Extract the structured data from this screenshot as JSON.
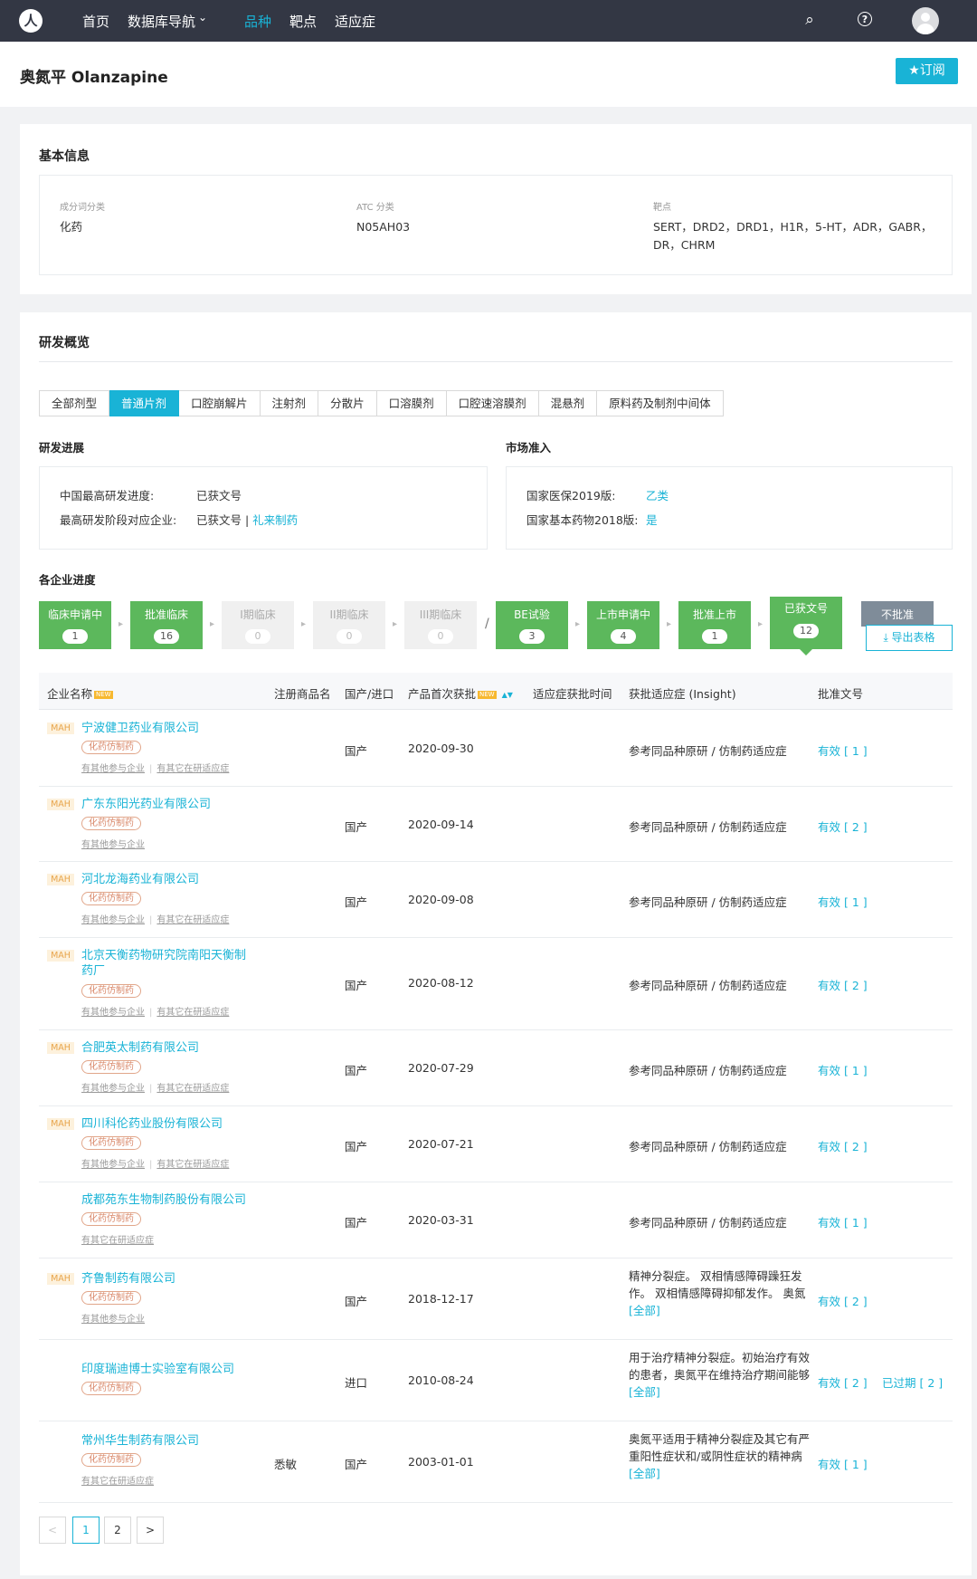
{
  "nav": {
    "logo": "人",
    "items": [
      "首页",
      "数据库导航",
      "品种",
      "靶点",
      "适应症"
    ],
    "dropdown_mark": "⌄",
    "search_icon": "⌕",
    "help_icon": "?"
  },
  "header": {
    "title": "奥氮平 Olanzapine",
    "subscribe": "★订阅"
  },
  "basic": {
    "title": "基本信息",
    "fields": [
      {
        "label": "成分词分类",
        "value": "化药"
      },
      {
        "label": "ATC 分类",
        "value": "N05AH03"
      },
      {
        "label": "靶点",
        "value": "SERT，DRD2，DRD1，H1R，5-HT，ADR，GABR，DR，CHRM"
      }
    ]
  },
  "rd": {
    "title": "研发概览",
    "tabs": [
      "全部剂型",
      "普通片剂",
      "口腔崩解片",
      "注射剂",
      "分散片",
      "口溶膜剂",
      "口腔速溶膜剂",
      "混悬剂",
      "原料药及制剂中间体"
    ],
    "progress_title": "研发进展",
    "progress": {
      "row1_label": "中国最高研发进度:",
      "row1_value": "已获文号",
      "row2_label": "最高研发阶段对应企业:",
      "row2_value": "已获文号 | ",
      "row2_link": "礼来制药"
    },
    "market_title": "市场准入",
    "market": {
      "row1_label": "国家医保2019版:",
      "row1_value": "乙类",
      "row2_label": "国家基本药物2018版:",
      "row2_value": "是"
    },
    "company_progress_title": "各企业进度",
    "stages": [
      {
        "name": "临床申请中",
        "count": "1"
      },
      {
        "name": "批准临床",
        "count": "16"
      },
      {
        "name": "I期临床",
        "count": "0"
      },
      {
        "name": "II期临床",
        "count": "0"
      },
      {
        "name": "III期临床",
        "count": "0"
      },
      {
        "name": "BE试验",
        "count": "3"
      },
      {
        "name": "上市申请中",
        "count": "4"
      },
      {
        "name": "批准上市",
        "count": "1"
      },
      {
        "name": "已获文号",
        "count": "12"
      },
      {
        "name": "不批准",
        "count": ""
      }
    ],
    "separator": "/",
    "export": "⤓ 导出表格"
  },
  "table": {
    "headers": [
      "企业名称",
      "注册商品名",
      "国产/进口",
      "产品首次获批",
      "适应症获批时间",
      "获批适应症 (Insight)",
      "批准文号"
    ],
    "new_badge": "NEW",
    "sort_mark": "▲▼",
    "mah": "MAH",
    "tag": "化药仿制药",
    "link_other_company": "有其他参与企业",
    "link_other_indication": "有其它在研适应症",
    "more": "[全部]",
    "rows": [
      {
        "company": "宁波健卫药业有限公司",
        "brand": "",
        "origin": "国产",
        "date": "2020-09-30",
        "indication": "参考同品种原研 / 仿制药适应症",
        "approval": "有效 [ 1 ]"
      },
      {
        "company": "广东东阳光药业有限公司",
        "brand": "",
        "origin": "国产",
        "date": "2020-09-14",
        "indication": "参考同品种原研 / 仿制药适应症",
        "approval": "有效 [ 2 ]"
      },
      {
        "company": "河北龙海药业有限公司",
        "brand": "",
        "origin": "国产",
        "date": "2020-09-08",
        "indication": "参考同品种原研 / 仿制药适应症",
        "approval": "有效 [ 1 ]"
      },
      {
        "company": "北京天衡药物研究院南阳天衡制药厂",
        "brand": "",
        "origin": "国产",
        "date": "2020-08-12",
        "indication": "参考同品种原研 / 仿制药适应症",
        "approval": "有效 [ 2 ]"
      },
      {
        "company": "合肥英太制药有限公司",
        "brand": "",
        "origin": "国产",
        "date": "2020-07-29",
        "indication": "参考同品种原研 / 仿制药适应症",
        "approval": "有效 [ 1 ]"
      },
      {
        "company": "四川科伦药业股份有限公司",
        "brand": "",
        "origin": "国产",
        "date": "2020-07-21",
        "indication": "参考同品种原研 / 仿制药适应症",
        "approval": "有效 [ 2 ]"
      },
      {
        "company": "成都苑东生物制药股份有限公司",
        "brand": "",
        "origin": "国产",
        "date": "2020-03-31",
        "indication": "参考同品种原研 / 仿制药适应症",
        "approval": "有效 [ 1 ]"
      },
      {
        "company": "齐鲁制药有限公司",
        "brand": "",
        "origin": "国产",
        "date": "2018-12-17",
        "indication": "精神分裂症。 双相情感障碍躁狂发作。 双相情感障碍抑郁发作。 奥氮平还能够有效地维持临床症状改善",
        "approval": "有效 [ 2 ]"
      },
      {
        "company": "印度瑞迪博士实验室有限公司",
        "brand": "",
        "origin": "进口",
        "date": "2010-08-24",
        "indication": "用于治疗精神分裂症。初始治疗有效的患者，奥氮平在维持治疗期间能够保持临床症状的改善",
        "approval": "有效 [ 2 ]",
        "approval2": "已过期 [ 2 ]"
      },
      {
        "company": "常州华生制药有限公司",
        "brand": "悉敏",
        "origin": "国产",
        "date": "2003-01-01",
        "indication": "奥氮平适用于精神分裂症及其它有严重阳性症状和/或阴性症状的精神病的急性期和维持治疗",
        "approval": "有效 [ 1 ]"
      }
    ]
  },
  "pagination": {
    "prev": "<",
    "pages": [
      "1",
      "2"
    ],
    "next": ">"
  },
  "colors": {
    "accent": "#19b3d6",
    "nav_bg": "#333744",
    "stage_green": "#5cb85c",
    "mah_bg": "#fdf1dc"
  }
}
